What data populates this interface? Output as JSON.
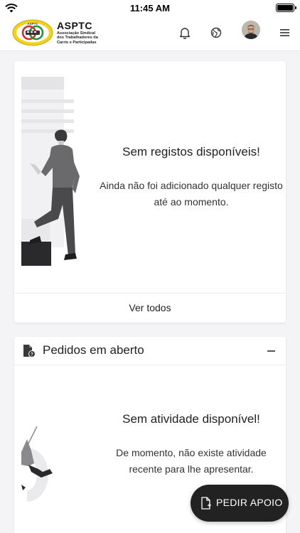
{
  "status_bar": {
    "time": "11:45 AM"
  },
  "header": {
    "logo_title": "ASPTC",
    "logo_subtitle": "Associação Sindical dos Trabalhadores da Carris e Participadas",
    "icons": [
      "bell-icon",
      "globe-icon",
      "avatar",
      "menu-icon"
    ]
  },
  "records_card": {
    "title": "Sem registos disponíveis!",
    "text": "Ainda não foi adicionado qualquer registo até ao momento.",
    "footer_link": "Ver todos"
  },
  "requests_card": {
    "title": "Pedidos em aberto",
    "empty_title": "Sem atividade disponível!",
    "empty_text": "De momento, não existe atividade recente para lhe apresentar."
  },
  "fab": {
    "label": "PEDIR APOIO"
  },
  "colors": {
    "background": "#f4f4f6",
    "card": "#ffffff",
    "fab": "#222222",
    "logo_yellow": "#f2d21b",
    "logo_red": "#d62b22",
    "logo_green": "#2e8b3a"
  }
}
